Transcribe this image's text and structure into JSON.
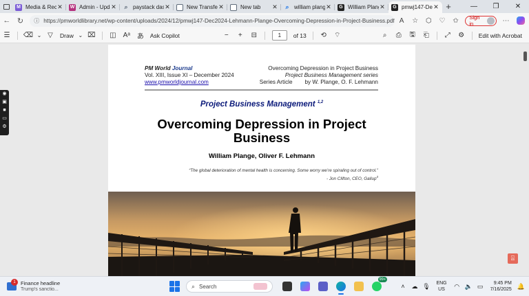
{
  "browser": {
    "tabs": [
      {
        "title": "Media & Reco",
        "icon": "media-icon",
        "color": "#7b5cd6"
      },
      {
        "title": "Admin - Upda",
        "icon": "wordpress-icon",
        "color": "#b5327e"
      },
      {
        "title": "paystack dash",
        "icon": "search-icon",
        "color": "#5f6b7a"
      },
      {
        "title": "New Transfer",
        "icon": "page-icon",
        "color": "#5f6b7a"
      },
      {
        "title": "New tab",
        "icon": "newtab-icon",
        "color": "#5f6b7a"
      },
      {
        "title": "william plange",
        "icon": "search-icon",
        "color": "#1a73e8"
      },
      {
        "title": "William Plang",
        "icon": "site-g-icon",
        "color": "#222222"
      },
      {
        "title": "pmwj147-Dec",
        "icon": "site-g-icon",
        "color": "#222222",
        "active": true
      }
    ],
    "url": "https://pmworldlibrary.net/wp-content/uploads/2024/12/pmwj147-Dec2024-Lehmann-Plange-Overcoming-Depression-in-Project-Business.pdf",
    "signin_label": "Sign in"
  },
  "pdf_toolbar": {
    "draw_label": "Draw",
    "copilot_label": "Ask Copilot",
    "page_current": "1",
    "page_total": "of 13",
    "edit_label": "Edit with Acrobat"
  },
  "document": {
    "journal_name": "PM World ",
    "journal_name_accent": "Journal",
    "issue": "Vol. XIII, Issue XI – December 2024",
    "website": "www.pmworldjournal.com",
    "header_title": "Overcoming Depression in Project Business",
    "series_name": "Project Business Management series",
    "article_type": "Series Article",
    "byline": "by W. Plange, O. F. Lehmann",
    "section": "Project Business Management ",
    "section_sup": "1,2",
    "title": "Overcoming Depression in Project Business",
    "authors": "William Plange, Oliver F. Lehmann",
    "quote": "“The global deterioration of mental health is concerning. Some worry we’re spiraling out of control.”",
    "quote_attribution": "- Jon Clifton, CEO, Gallup",
    "quote_sup": "3"
  },
  "taskbar": {
    "news_title": "Finance headline",
    "news_sub": "Trump's sanctio...",
    "news_badge": "1",
    "search_label": "Search",
    "whatsapp_badge": "99+",
    "lang_line1": "ENG",
    "lang_line2": "US",
    "time": "9:45 PM",
    "date": "7/16/2025"
  }
}
